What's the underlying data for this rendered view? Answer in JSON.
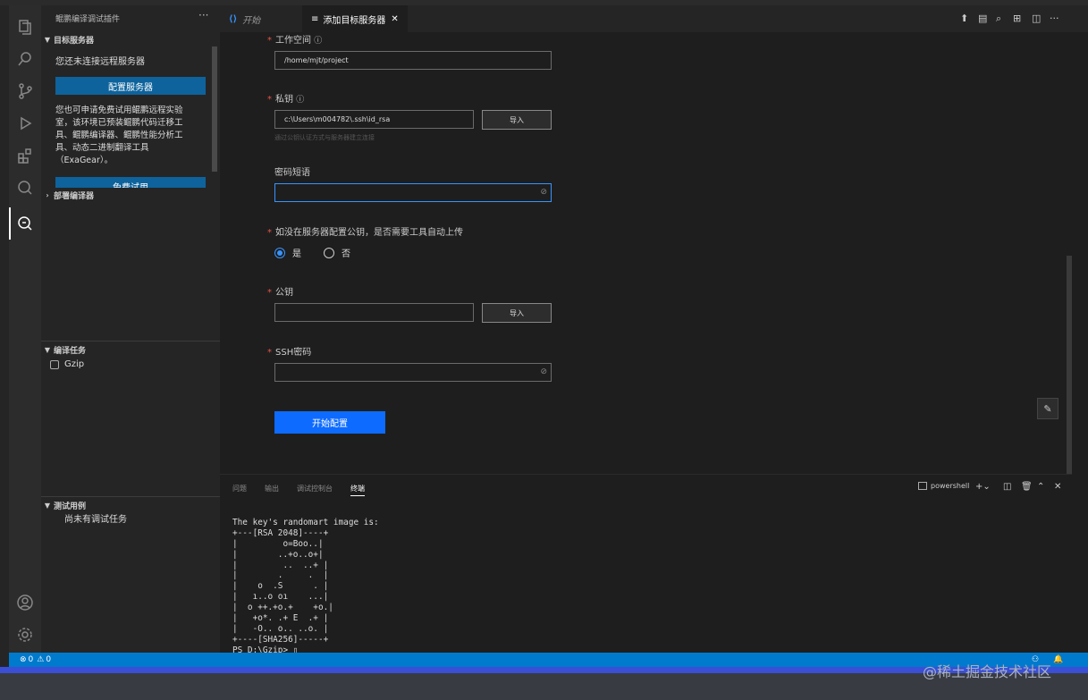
{
  "sidebar": {
    "title": "鲲鹏编译调试插件",
    "more": "···",
    "target_section": "目标服务器",
    "not_connected": "您还未连接远程服务器",
    "configure_button": "配置服务器",
    "trial_text": [
      "您也可申请免费试用鲲鹏远程实验",
      "室，该环境已预装鲲鹏代码迁移工",
      "具、鲲鹏编译器、鲲鹏性能分析工",
      "具、动态二进制翻译工具",
      "（ExaGear）。"
    ],
    "trial_button": "免费试用",
    "deploy_section": "部署编译器",
    "compile_section": "编译任务",
    "compile_item": "Gzip",
    "test_section": "测试用例",
    "test_empty": "尚未有调试任务"
  },
  "tabs": [
    {
      "label": "开始",
      "icon": "vscode-logo-icon"
    },
    {
      "label": "添加目标服务器",
      "icon": "list-icon",
      "close": "✕"
    }
  ],
  "form": {
    "workspace_label": "工作空间",
    "workspace_value": "/home/mjt/project",
    "private_key_label": "私钥",
    "private_key_value": "c:\\Users\\m004782\\.ssh\\id_rsa",
    "import_label": "导入",
    "private_key_hint": "通过公钥认证方式与服务器建立连接",
    "passphrase_label": "密码短语",
    "auto_upload_label": "如没在服务器配置公钥，是否需要工具自动上传",
    "yes": "是",
    "no": "否",
    "public_key_label": "公钥",
    "ssh_password_label": "SSH密码",
    "start_button": "开始配置",
    "required_mark": "*"
  },
  "panel": {
    "tabs": [
      "问题",
      "输出",
      "调试控制台",
      "终端"
    ],
    "shell": "powershell",
    "terminal_lines": [
      "The key's randomart image is:",
      "+---[RSA 2048]----+",
      "|         o=Boo..|",
      "|        ..+o..o+|",
      "|         ..  ..+ |",
      "|        .     .  |",
      "|    o  .S      . |",
      "|   ı..o oı    ...|",
      "|  o ++.+o.+    +o.|",
      "|   +o*. .+ E  .+ |",
      "|   -O.. o.. ..o. |",
      "+----[SHA256]-----+",
      "PS D:\\Gzip> ▯"
    ]
  },
  "status": {
    "errors": "0",
    "warnings": "0"
  },
  "watermark": "@稀土掘金技术社区",
  "colors": {
    "accent": "#007acc",
    "primary_button": "#0e6bff",
    "required": "#e5534b"
  }
}
